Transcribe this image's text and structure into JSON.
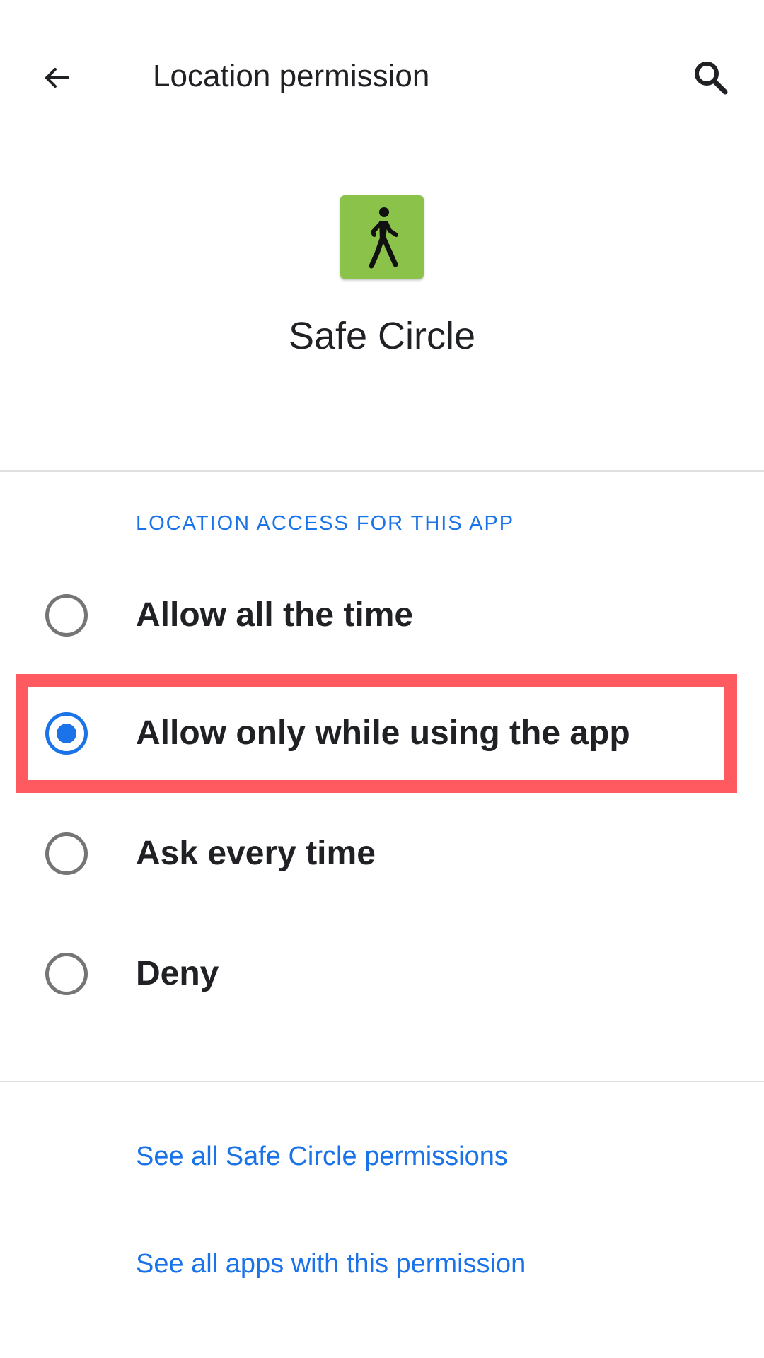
{
  "app_bar": {
    "back_icon": "arrow-left-icon",
    "title": "Location permission",
    "search_icon": "search-icon"
  },
  "app": {
    "name": "Safe Circle",
    "icon": "walking-person-icon",
    "icon_bg_color": "#8bc34a"
  },
  "section": {
    "header": "LOCATION ACCESS FOR THIS APP"
  },
  "options": [
    {
      "label": "Allow all the time",
      "selected": false
    },
    {
      "label": "Allow only while using the app",
      "selected": true
    },
    {
      "label": "Ask every time",
      "selected": false
    },
    {
      "label": "Deny",
      "selected": false
    }
  ],
  "links": {
    "app_permissions": "See all Safe Circle permissions",
    "apps_with_permission": "See all apps with this permission"
  },
  "colors": {
    "accent": "#1a73e8",
    "highlight": "#ff5a5f",
    "radio_unselected": "#757575"
  }
}
